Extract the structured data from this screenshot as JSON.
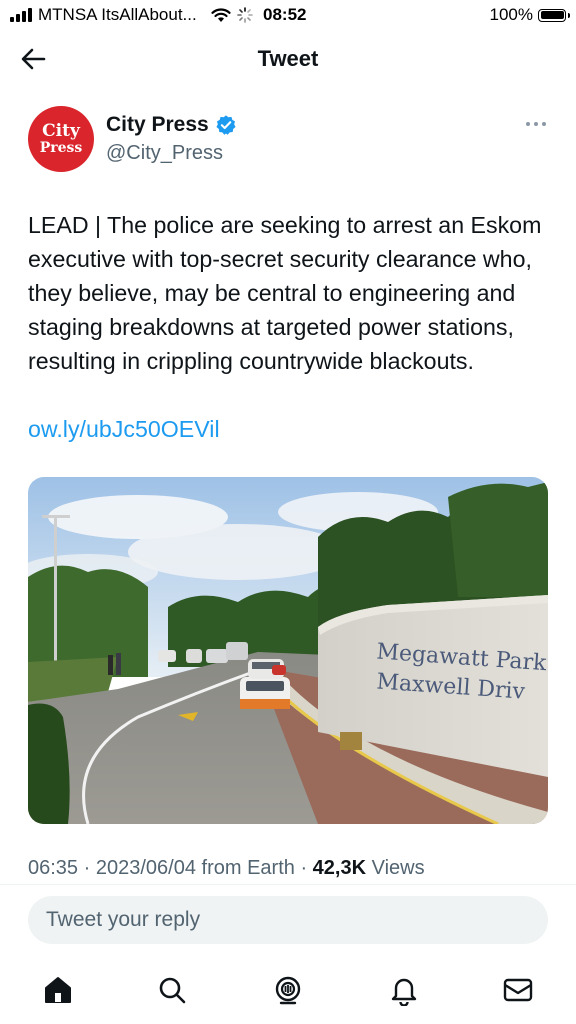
{
  "status_bar": {
    "carrier": "MTNSA ItsAllAbout...",
    "time": "08:52",
    "battery": "100%"
  },
  "header": {
    "title": "Tweet",
    "back_icon": "arrow-left-icon"
  },
  "author": {
    "avatar_line1": "City",
    "avatar_line2": "Press",
    "avatar_color": "#d9252b",
    "name": "City Press",
    "handle": "@City_Press",
    "verified": true
  },
  "tweet": {
    "text": "LEAD | The police are seeking to arrest an Eskom executive with top-secret security clearance who, they believe, may be central to engineering and staging breakdowns at targeted power stations, resulting in crippling countrywide blackouts.",
    "link": "ow.ly/ubJc50OEVil",
    "link_color": "#1d9bf0",
    "image_sign_line1": "Megawatt Park",
    "image_sign_line2": "Maxwell Driv"
  },
  "meta": {
    "time": "06:35",
    "date": "2023/06/04",
    "source": "from Earth",
    "views_count": "42,3K",
    "views_label": "Views"
  },
  "reply": {
    "placeholder": "Tweet your reply"
  },
  "tabbar": {
    "items": [
      "home-icon",
      "search-icon",
      "spaces-icon",
      "notifications-icon",
      "messages-icon"
    ]
  }
}
